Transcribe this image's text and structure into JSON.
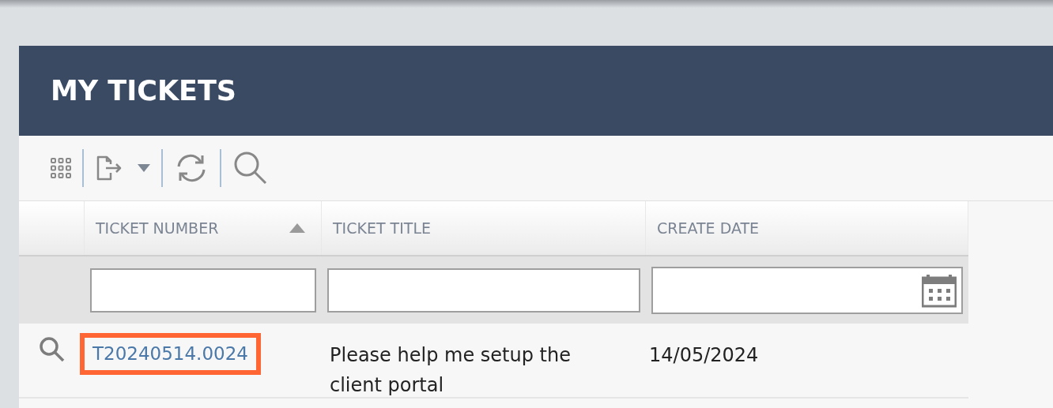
{
  "panel": {
    "title": "MY TICKETS"
  },
  "table": {
    "columns": [
      {
        "label": "TICKET NUMBER",
        "sorted_ascending": true,
        "date_filter": false
      },
      {
        "label": "TICKET TITLE",
        "sorted_ascending": false,
        "date_filter": false
      },
      {
        "label": "CREATE DATE",
        "sorted_ascending": false,
        "date_filter": true
      }
    ],
    "rows": [
      {
        "ticket_number": "T20240514.0024",
        "ticket_title": "Please help me setup the client portal",
        "create_date": "14/05/2024",
        "highlighted": true
      }
    ]
  }
}
